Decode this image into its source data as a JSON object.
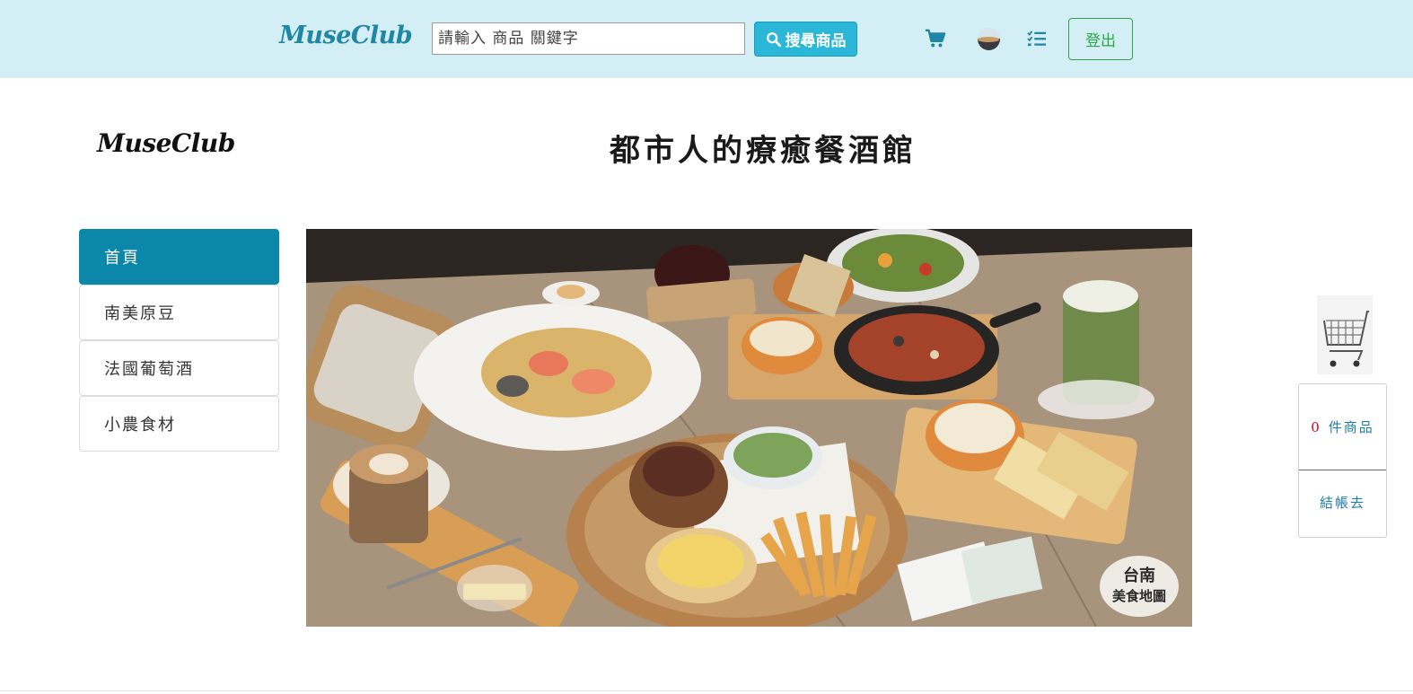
{
  "navbar": {
    "brand": "MuseClub",
    "search_placeholder": "請輸入 商品 關鍵字",
    "search_button": "搜尋商品",
    "logout": "登出",
    "icons": [
      "cart-icon",
      "avatar",
      "list-check-icon"
    ],
    "background": "#d3eff5"
  },
  "header": {
    "brand": "MuseClub",
    "title": "都市人的療癒餐酒館"
  },
  "sidebar": {
    "items": [
      {
        "label": "首頁",
        "active": true
      },
      {
        "label": "南美原豆",
        "active": false
      },
      {
        "label": "法國葡萄酒",
        "active": false
      },
      {
        "label": "小農食材",
        "active": false
      }
    ],
    "active_color": "#0b87a9"
  },
  "hero": {
    "watermark_line1": "台南",
    "watermark_line2": "美食地圖"
  },
  "floating_cart": {
    "count": "0",
    "count_label": "件商品",
    "checkout": "結帳去"
  }
}
